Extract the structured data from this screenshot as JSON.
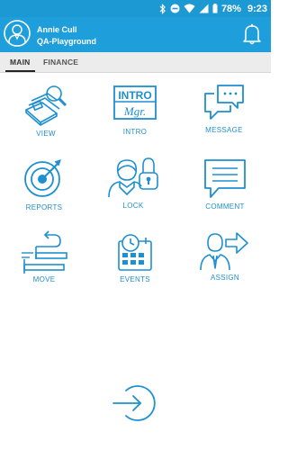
{
  "status": {
    "battery": "78%",
    "time": "9:23"
  },
  "header": {
    "user_name": "Annie Cull",
    "user_org": "QA-Playground"
  },
  "tabs": [
    {
      "label": "MAIN"
    },
    {
      "label": "FINANCE"
    }
  ],
  "tiles": [
    {
      "label": "VIEW"
    },
    {
      "label": "INTRO"
    },
    {
      "label": "MESSAGE"
    },
    {
      "label": "REPORTS"
    },
    {
      "label": "LOCK"
    },
    {
      "label": "COMMENT"
    },
    {
      "label": "MOVE"
    },
    {
      "label": "EVENTS"
    },
    {
      "label": "ASSIGN"
    }
  ],
  "intro_icon": {
    "line1": "INTRO",
    "line2": "Mgr."
  },
  "accent_color": "#1e9edb",
  "icon_color": "#1e8fd0"
}
